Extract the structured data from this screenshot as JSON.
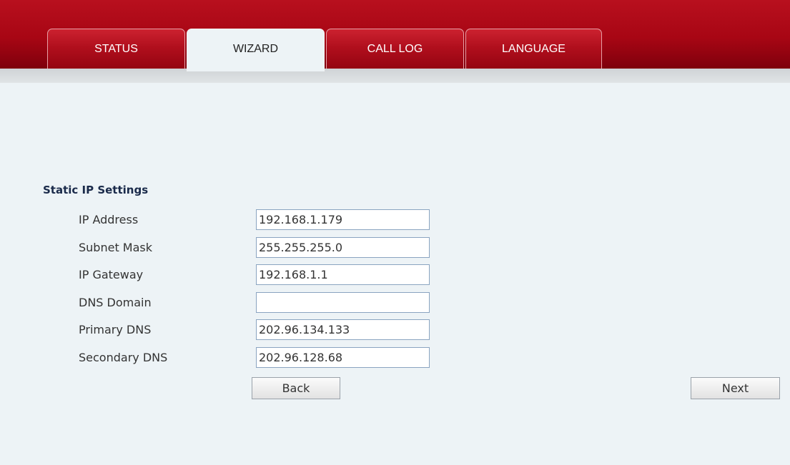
{
  "tabs": [
    {
      "label": "STATUS",
      "active": false
    },
    {
      "label": "WIZARD",
      "active": true
    },
    {
      "label": "CALL LOG",
      "active": false
    },
    {
      "label": "LANGUAGE",
      "active": false
    }
  ],
  "colors": {
    "header": "#a80614",
    "content_bg": "#edf3f6",
    "input_border": "#8aa4c0"
  },
  "section": {
    "title": "Static IP Settings"
  },
  "fields": [
    {
      "label": "IP Address",
      "value": "192.168.1.179"
    },
    {
      "label": "Subnet Mask",
      "value": "255.255.255.0"
    },
    {
      "label": "IP Gateway",
      "value": "192.168.1.1"
    },
    {
      "label": "DNS Domain",
      "value": ""
    },
    {
      "label": "Primary DNS",
      "value": "202.96.134.133"
    },
    {
      "label": "Secondary DNS",
      "value": "202.96.128.68"
    }
  ],
  "buttons": {
    "back": "Back",
    "next": "Next"
  }
}
